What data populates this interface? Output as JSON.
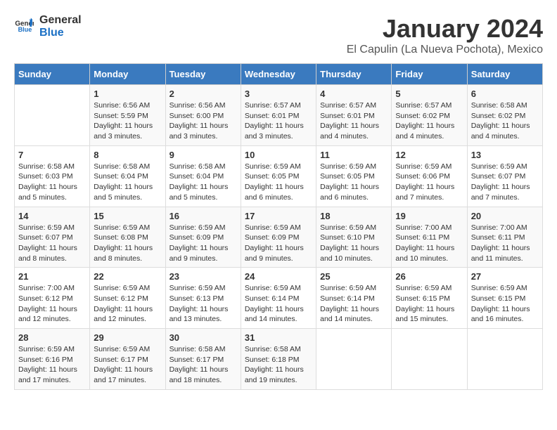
{
  "logo": {
    "general": "General",
    "blue": "Blue"
  },
  "title": "January 2024",
  "location": "El Capulin (La Nueva Pochota), Mexico",
  "headers": [
    "Sunday",
    "Monday",
    "Tuesday",
    "Wednesday",
    "Thursday",
    "Friday",
    "Saturday"
  ],
  "weeks": [
    [
      {
        "day": "",
        "sunrise": "",
        "sunset": "",
        "daylight": ""
      },
      {
        "day": "1",
        "sunrise": "Sunrise: 6:56 AM",
        "sunset": "Sunset: 5:59 PM",
        "daylight": "Daylight: 11 hours and 3 minutes."
      },
      {
        "day": "2",
        "sunrise": "Sunrise: 6:56 AM",
        "sunset": "Sunset: 6:00 PM",
        "daylight": "Daylight: 11 hours and 3 minutes."
      },
      {
        "day": "3",
        "sunrise": "Sunrise: 6:57 AM",
        "sunset": "Sunset: 6:01 PM",
        "daylight": "Daylight: 11 hours and 3 minutes."
      },
      {
        "day": "4",
        "sunrise": "Sunrise: 6:57 AM",
        "sunset": "Sunset: 6:01 PM",
        "daylight": "Daylight: 11 hours and 4 minutes."
      },
      {
        "day": "5",
        "sunrise": "Sunrise: 6:57 AM",
        "sunset": "Sunset: 6:02 PM",
        "daylight": "Daylight: 11 hours and 4 minutes."
      },
      {
        "day": "6",
        "sunrise": "Sunrise: 6:58 AM",
        "sunset": "Sunset: 6:02 PM",
        "daylight": "Daylight: 11 hours and 4 minutes."
      }
    ],
    [
      {
        "day": "7",
        "sunrise": "Sunrise: 6:58 AM",
        "sunset": "Sunset: 6:03 PM",
        "daylight": "Daylight: 11 hours and 5 minutes."
      },
      {
        "day": "8",
        "sunrise": "Sunrise: 6:58 AM",
        "sunset": "Sunset: 6:04 PM",
        "daylight": "Daylight: 11 hours and 5 minutes."
      },
      {
        "day": "9",
        "sunrise": "Sunrise: 6:58 AM",
        "sunset": "Sunset: 6:04 PM",
        "daylight": "Daylight: 11 hours and 5 minutes."
      },
      {
        "day": "10",
        "sunrise": "Sunrise: 6:59 AM",
        "sunset": "Sunset: 6:05 PM",
        "daylight": "Daylight: 11 hours and 6 minutes."
      },
      {
        "day": "11",
        "sunrise": "Sunrise: 6:59 AM",
        "sunset": "Sunset: 6:05 PM",
        "daylight": "Daylight: 11 hours and 6 minutes."
      },
      {
        "day": "12",
        "sunrise": "Sunrise: 6:59 AM",
        "sunset": "Sunset: 6:06 PM",
        "daylight": "Daylight: 11 hours and 7 minutes."
      },
      {
        "day": "13",
        "sunrise": "Sunrise: 6:59 AM",
        "sunset": "Sunset: 6:07 PM",
        "daylight": "Daylight: 11 hours and 7 minutes."
      }
    ],
    [
      {
        "day": "14",
        "sunrise": "Sunrise: 6:59 AM",
        "sunset": "Sunset: 6:07 PM",
        "daylight": "Daylight: 11 hours and 8 minutes."
      },
      {
        "day": "15",
        "sunrise": "Sunrise: 6:59 AM",
        "sunset": "Sunset: 6:08 PM",
        "daylight": "Daylight: 11 hours and 8 minutes."
      },
      {
        "day": "16",
        "sunrise": "Sunrise: 6:59 AM",
        "sunset": "Sunset: 6:09 PM",
        "daylight": "Daylight: 11 hours and 9 minutes."
      },
      {
        "day": "17",
        "sunrise": "Sunrise: 6:59 AM",
        "sunset": "Sunset: 6:09 PM",
        "daylight": "Daylight: 11 hours and 9 minutes."
      },
      {
        "day": "18",
        "sunrise": "Sunrise: 6:59 AM",
        "sunset": "Sunset: 6:10 PM",
        "daylight": "Daylight: 11 hours and 10 minutes."
      },
      {
        "day": "19",
        "sunrise": "Sunrise: 7:00 AM",
        "sunset": "Sunset: 6:11 PM",
        "daylight": "Daylight: 11 hours and 10 minutes."
      },
      {
        "day": "20",
        "sunrise": "Sunrise: 7:00 AM",
        "sunset": "Sunset: 6:11 PM",
        "daylight": "Daylight: 11 hours and 11 minutes."
      }
    ],
    [
      {
        "day": "21",
        "sunrise": "Sunrise: 7:00 AM",
        "sunset": "Sunset: 6:12 PM",
        "daylight": "Daylight: 11 hours and 12 minutes."
      },
      {
        "day": "22",
        "sunrise": "Sunrise: 6:59 AM",
        "sunset": "Sunset: 6:12 PM",
        "daylight": "Daylight: 11 hours and 12 minutes."
      },
      {
        "day": "23",
        "sunrise": "Sunrise: 6:59 AM",
        "sunset": "Sunset: 6:13 PM",
        "daylight": "Daylight: 11 hours and 13 minutes."
      },
      {
        "day": "24",
        "sunrise": "Sunrise: 6:59 AM",
        "sunset": "Sunset: 6:14 PM",
        "daylight": "Daylight: 11 hours and 14 minutes."
      },
      {
        "day": "25",
        "sunrise": "Sunrise: 6:59 AM",
        "sunset": "Sunset: 6:14 PM",
        "daylight": "Daylight: 11 hours and 14 minutes."
      },
      {
        "day": "26",
        "sunrise": "Sunrise: 6:59 AM",
        "sunset": "Sunset: 6:15 PM",
        "daylight": "Daylight: 11 hours and 15 minutes."
      },
      {
        "day": "27",
        "sunrise": "Sunrise: 6:59 AM",
        "sunset": "Sunset: 6:15 PM",
        "daylight": "Daylight: 11 hours and 16 minutes."
      }
    ],
    [
      {
        "day": "28",
        "sunrise": "Sunrise: 6:59 AM",
        "sunset": "Sunset: 6:16 PM",
        "daylight": "Daylight: 11 hours and 17 minutes."
      },
      {
        "day": "29",
        "sunrise": "Sunrise: 6:59 AM",
        "sunset": "Sunset: 6:17 PM",
        "daylight": "Daylight: 11 hours and 17 minutes."
      },
      {
        "day": "30",
        "sunrise": "Sunrise: 6:58 AM",
        "sunset": "Sunset: 6:17 PM",
        "daylight": "Daylight: 11 hours and 18 minutes."
      },
      {
        "day": "31",
        "sunrise": "Sunrise: 6:58 AM",
        "sunset": "Sunset: 6:18 PM",
        "daylight": "Daylight: 11 hours and 19 minutes."
      },
      {
        "day": "",
        "sunrise": "",
        "sunset": "",
        "daylight": ""
      },
      {
        "day": "",
        "sunrise": "",
        "sunset": "",
        "daylight": ""
      },
      {
        "day": "",
        "sunrise": "",
        "sunset": "",
        "daylight": ""
      }
    ]
  ]
}
